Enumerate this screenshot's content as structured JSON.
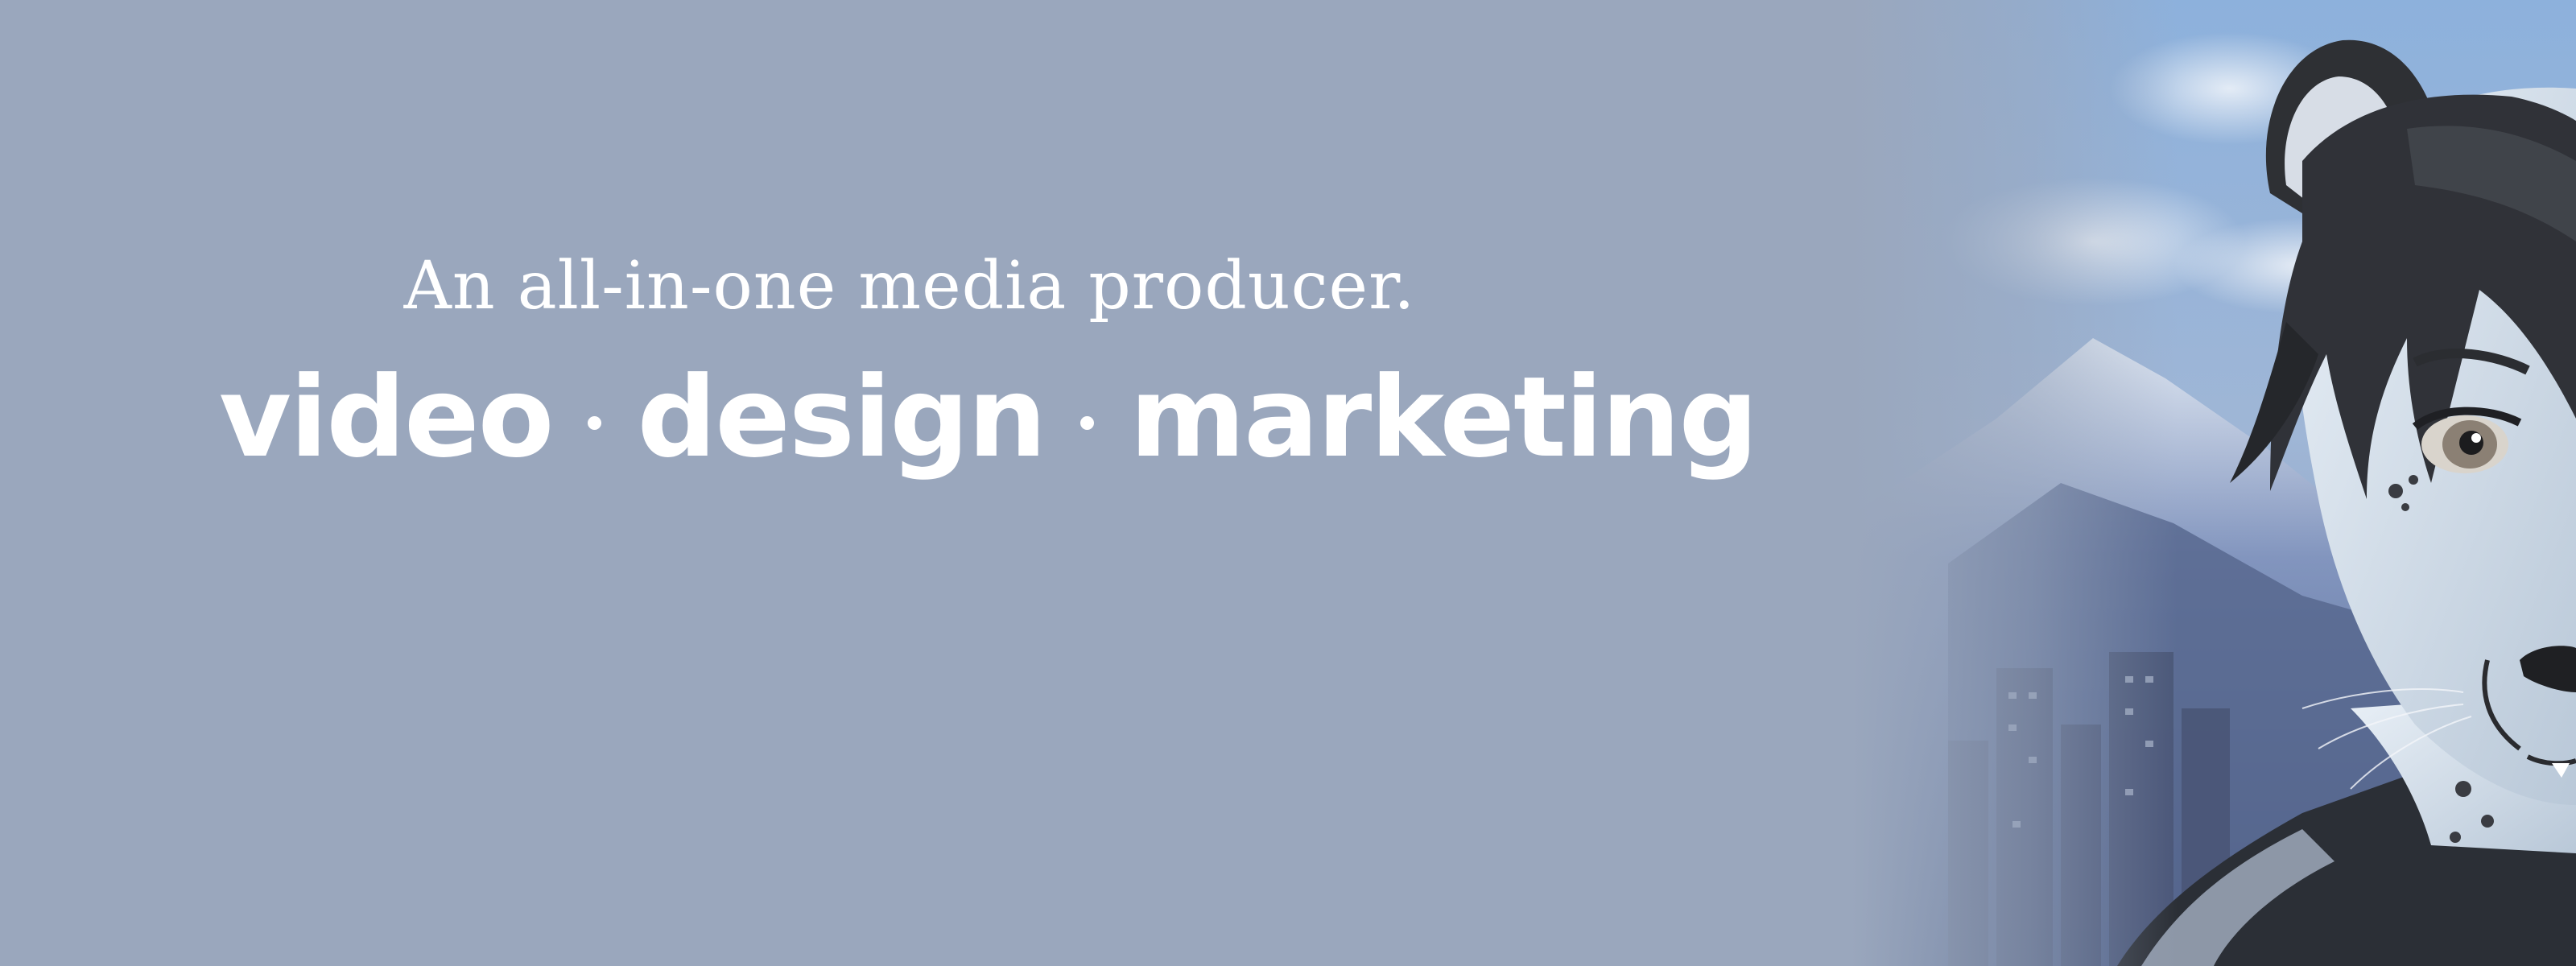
{
  "banner": {
    "tagline": "An all-in-one media producer.",
    "services": [
      "video",
      "design",
      "marketing"
    ],
    "separator": "·"
  },
  "colors": {
    "background": "#9aa7bd",
    "text": "#ffffff",
    "sky": "#8fb2db",
    "mountain": "#5e73a1",
    "fur_light": "#dbe6f0",
    "hair_dark": "#2f3134"
  },
  "artwork": {
    "subject": "snow-leopard-character-illustration"
  }
}
